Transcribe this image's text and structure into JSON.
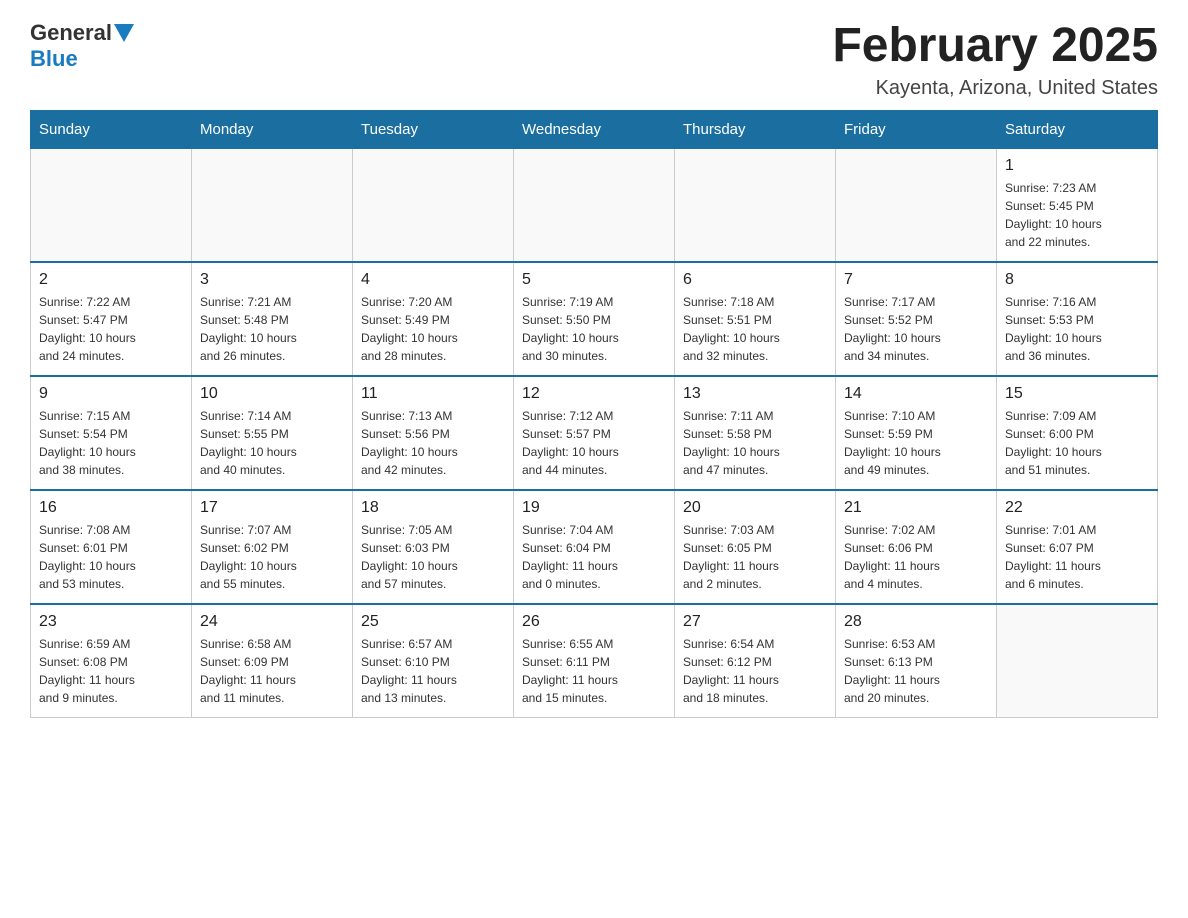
{
  "header": {
    "logo_general": "General",
    "logo_blue": "Blue",
    "month_title": "February 2025",
    "location": "Kayenta, Arizona, United States"
  },
  "weekdays": [
    "Sunday",
    "Monday",
    "Tuesday",
    "Wednesday",
    "Thursday",
    "Friday",
    "Saturday"
  ],
  "weeks": [
    [
      {
        "day": "",
        "info": ""
      },
      {
        "day": "",
        "info": ""
      },
      {
        "day": "",
        "info": ""
      },
      {
        "day": "",
        "info": ""
      },
      {
        "day": "",
        "info": ""
      },
      {
        "day": "",
        "info": ""
      },
      {
        "day": "1",
        "info": "Sunrise: 7:23 AM\nSunset: 5:45 PM\nDaylight: 10 hours\nand 22 minutes."
      }
    ],
    [
      {
        "day": "2",
        "info": "Sunrise: 7:22 AM\nSunset: 5:47 PM\nDaylight: 10 hours\nand 24 minutes."
      },
      {
        "day": "3",
        "info": "Sunrise: 7:21 AM\nSunset: 5:48 PM\nDaylight: 10 hours\nand 26 minutes."
      },
      {
        "day": "4",
        "info": "Sunrise: 7:20 AM\nSunset: 5:49 PM\nDaylight: 10 hours\nand 28 minutes."
      },
      {
        "day": "5",
        "info": "Sunrise: 7:19 AM\nSunset: 5:50 PM\nDaylight: 10 hours\nand 30 minutes."
      },
      {
        "day": "6",
        "info": "Sunrise: 7:18 AM\nSunset: 5:51 PM\nDaylight: 10 hours\nand 32 minutes."
      },
      {
        "day": "7",
        "info": "Sunrise: 7:17 AM\nSunset: 5:52 PM\nDaylight: 10 hours\nand 34 minutes."
      },
      {
        "day": "8",
        "info": "Sunrise: 7:16 AM\nSunset: 5:53 PM\nDaylight: 10 hours\nand 36 minutes."
      }
    ],
    [
      {
        "day": "9",
        "info": "Sunrise: 7:15 AM\nSunset: 5:54 PM\nDaylight: 10 hours\nand 38 minutes."
      },
      {
        "day": "10",
        "info": "Sunrise: 7:14 AM\nSunset: 5:55 PM\nDaylight: 10 hours\nand 40 minutes."
      },
      {
        "day": "11",
        "info": "Sunrise: 7:13 AM\nSunset: 5:56 PM\nDaylight: 10 hours\nand 42 minutes."
      },
      {
        "day": "12",
        "info": "Sunrise: 7:12 AM\nSunset: 5:57 PM\nDaylight: 10 hours\nand 44 minutes."
      },
      {
        "day": "13",
        "info": "Sunrise: 7:11 AM\nSunset: 5:58 PM\nDaylight: 10 hours\nand 47 minutes."
      },
      {
        "day": "14",
        "info": "Sunrise: 7:10 AM\nSunset: 5:59 PM\nDaylight: 10 hours\nand 49 minutes."
      },
      {
        "day": "15",
        "info": "Sunrise: 7:09 AM\nSunset: 6:00 PM\nDaylight: 10 hours\nand 51 minutes."
      }
    ],
    [
      {
        "day": "16",
        "info": "Sunrise: 7:08 AM\nSunset: 6:01 PM\nDaylight: 10 hours\nand 53 minutes."
      },
      {
        "day": "17",
        "info": "Sunrise: 7:07 AM\nSunset: 6:02 PM\nDaylight: 10 hours\nand 55 minutes."
      },
      {
        "day": "18",
        "info": "Sunrise: 7:05 AM\nSunset: 6:03 PM\nDaylight: 10 hours\nand 57 minutes."
      },
      {
        "day": "19",
        "info": "Sunrise: 7:04 AM\nSunset: 6:04 PM\nDaylight: 11 hours\nand 0 minutes."
      },
      {
        "day": "20",
        "info": "Sunrise: 7:03 AM\nSunset: 6:05 PM\nDaylight: 11 hours\nand 2 minutes."
      },
      {
        "day": "21",
        "info": "Sunrise: 7:02 AM\nSunset: 6:06 PM\nDaylight: 11 hours\nand 4 minutes."
      },
      {
        "day": "22",
        "info": "Sunrise: 7:01 AM\nSunset: 6:07 PM\nDaylight: 11 hours\nand 6 minutes."
      }
    ],
    [
      {
        "day": "23",
        "info": "Sunrise: 6:59 AM\nSunset: 6:08 PM\nDaylight: 11 hours\nand 9 minutes."
      },
      {
        "day": "24",
        "info": "Sunrise: 6:58 AM\nSunset: 6:09 PM\nDaylight: 11 hours\nand 11 minutes."
      },
      {
        "day": "25",
        "info": "Sunrise: 6:57 AM\nSunset: 6:10 PM\nDaylight: 11 hours\nand 13 minutes."
      },
      {
        "day": "26",
        "info": "Sunrise: 6:55 AM\nSunset: 6:11 PM\nDaylight: 11 hours\nand 15 minutes."
      },
      {
        "day": "27",
        "info": "Sunrise: 6:54 AM\nSunset: 6:12 PM\nDaylight: 11 hours\nand 18 minutes."
      },
      {
        "day": "28",
        "info": "Sunrise: 6:53 AM\nSunset: 6:13 PM\nDaylight: 11 hours\nand 20 minutes."
      },
      {
        "day": "",
        "info": ""
      }
    ]
  ]
}
